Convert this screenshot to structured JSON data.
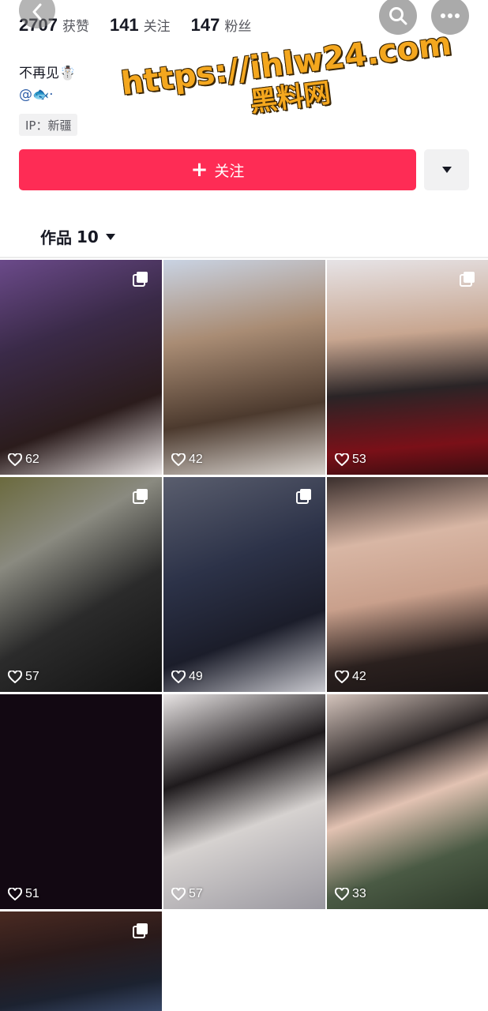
{
  "stats": [
    {
      "number": "2707",
      "label": "获赞"
    },
    {
      "number": "141",
      "label": "关注"
    },
    {
      "number": "147",
      "label": "粉丝"
    }
  ],
  "profile": {
    "nickname": "不再见☃️",
    "handle": "@🐟·",
    "ip": "IP：新疆"
  },
  "watermark": {
    "url": "https://ihlw24.com",
    "name": "黑料网"
  },
  "actions": {
    "follow_label": "关注"
  },
  "tab": {
    "label": "作品",
    "count": "10"
  },
  "posts": [
    {
      "likes": "62",
      "multi": true
    },
    {
      "likes": "42",
      "multi": false
    },
    {
      "likes": "53",
      "multi": true
    },
    {
      "likes": "57",
      "multi": true
    },
    {
      "likes": "49",
      "multi": true
    },
    {
      "likes": "42",
      "multi": false
    },
    {
      "likes": "51",
      "multi": false
    },
    {
      "likes": "57",
      "multi": false
    },
    {
      "likes": "33",
      "multi": false
    },
    {
      "likes": "",
      "multi": true
    }
  ],
  "colors": {
    "accent": "#fe2c55",
    "watermark": "#f4a71e"
  },
  "icons": [
    "back-icon",
    "search-icon",
    "more-icon",
    "plus-icon",
    "caret-down-icon",
    "heart-icon",
    "multi-image-icon"
  ]
}
